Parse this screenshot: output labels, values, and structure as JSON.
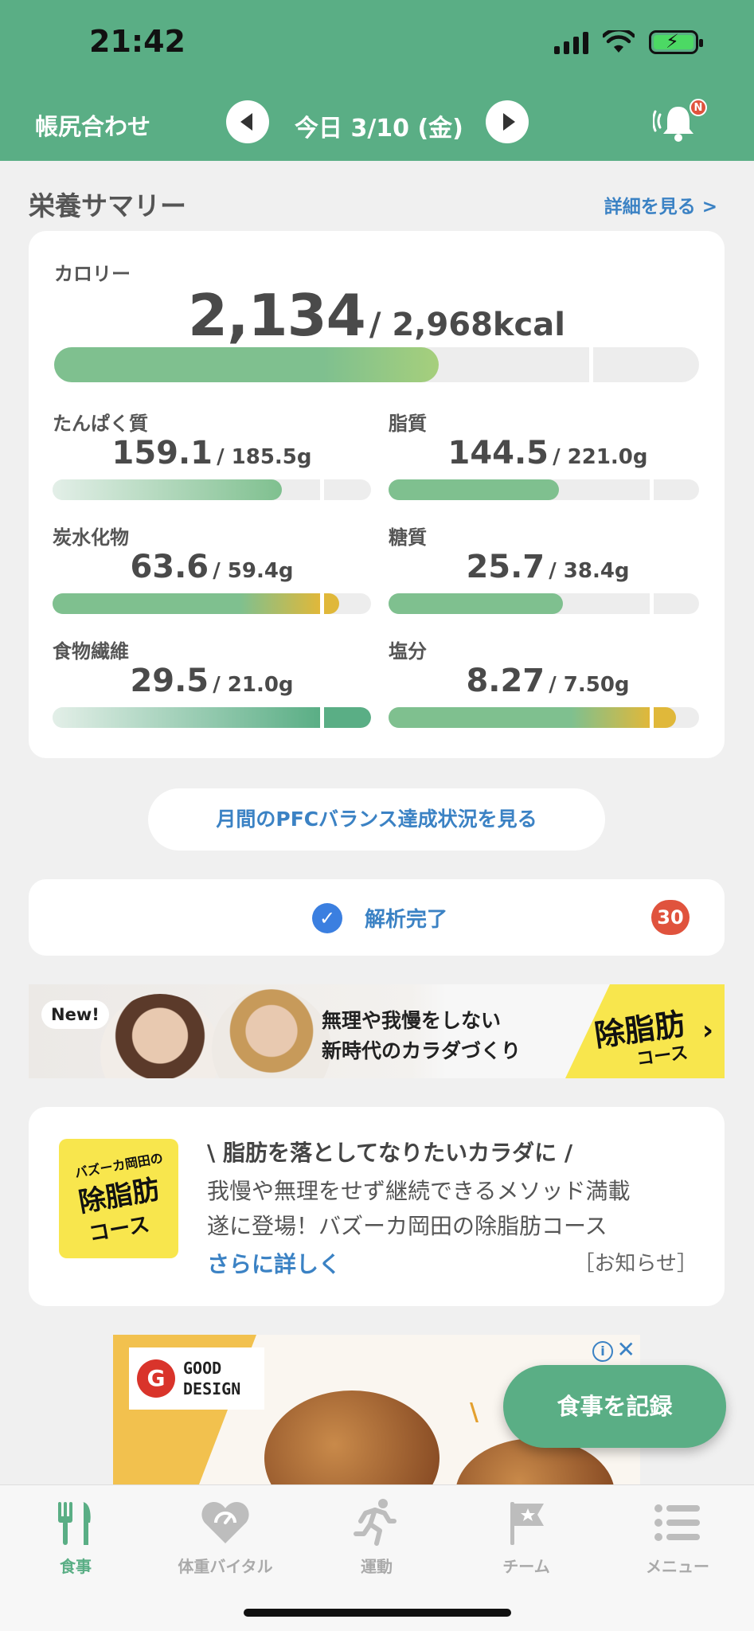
{
  "status_bar": {
    "time": "21:42"
  },
  "header": {
    "left_title": "帳尻合わせ",
    "date": "今日 3/10 (金)",
    "notification_badge": "N"
  },
  "summary": {
    "title": "栄養サマリー",
    "detail_link": "詳細を見る >",
    "calorie": {
      "label": "カロリー",
      "value": "2,134",
      "target": "/ 2,968kcal",
      "progress": 0.719
    },
    "nutrients": [
      {
        "name": "たんぱく質",
        "value": "159.1",
        "target": "/ 185.5g",
        "progress": 0.858
      },
      {
        "name": "脂質",
        "value": "144.5",
        "target": "/ 221.0g",
        "progress": 0.654
      },
      {
        "name": "炭水化物",
        "value": "63.6",
        "target": "/ 59.4g",
        "progress": 1.071
      },
      {
        "name": "糖質",
        "value": "25.7",
        "target": "/ 38.4g",
        "progress": 0.669
      },
      {
        "name": "食物繊維",
        "value": "29.5",
        "target": "/ 21.0g",
        "progress": 1.405
      },
      {
        "name": "塩分",
        "value": "8.27",
        "target": "/ 7.50g",
        "progress": 1.103
      }
    ]
  },
  "pfc_button": "月間のPFCバランス達成状況を見る",
  "analysis": {
    "label": "解析完了",
    "count": "30"
  },
  "banner": {
    "badge": "New!",
    "line1": "無理や我慢をしない",
    "line2": "新時代のカラダづくり",
    "course_title": "除脂肪",
    "course_sub": "コース"
  },
  "notice": {
    "logo_line1": "バズーカ岡田の",
    "logo_line2": "除脂肪",
    "logo_line3": "コース",
    "headline": "\\ 脂肪を落としてなりたいカラダに /",
    "line1": "我慢や無理をせず継続できるメソッド満載",
    "line2": "遂に登場！バズーカ岡田の除脂肪コース",
    "more": "さらに詳しく",
    "tag": "［お知らせ］"
  },
  "ad": {
    "brand_line1": "GOOD",
    "brand_line2": "DESIGN"
  },
  "fab": "食事を記録",
  "tabs": [
    {
      "label": "食事",
      "icon": "fork-knife-icon",
      "active": true
    },
    {
      "label": "体重バイタル",
      "icon": "heart-scale-icon",
      "active": false
    },
    {
      "label": "運動",
      "icon": "runner-icon",
      "active": false
    },
    {
      "label": "チーム",
      "icon": "flag-star-icon",
      "active": false
    },
    {
      "label": "メニュー",
      "icon": "list-menu-icon",
      "active": false
    }
  ],
  "colors": {
    "brand_green": "#5aae85",
    "link_blue": "#3b82c4",
    "alert_red": "#e0533d",
    "over_yellow": "#e0b83a"
  }
}
